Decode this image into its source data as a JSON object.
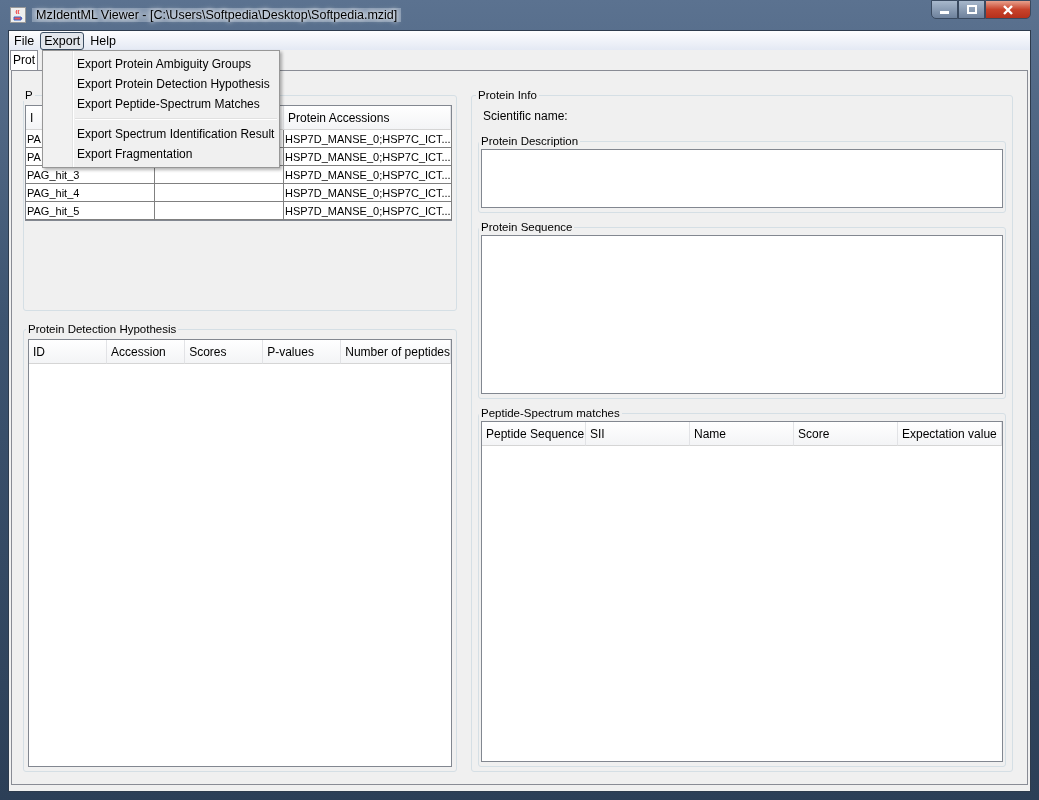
{
  "window": {
    "title": "MzIdentML Viewer   -  [C:\\Users\\Softpedia\\Desktop\\Softpedia.mzid]"
  },
  "menu_bar": [
    {
      "label": "File",
      "selected": false
    },
    {
      "label": "Export",
      "selected": true
    },
    {
      "label": "Help",
      "selected": false
    }
  ],
  "export_menu": [
    {
      "kind": "item",
      "label": "Export Protein Ambiguity Groups"
    },
    {
      "kind": "item",
      "label": "Export Protein Detection Hypothesis"
    },
    {
      "kind": "item",
      "label": "Export Peptide-Spectrum Matches"
    },
    {
      "kind": "separator"
    },
    {
      "kind": "item",
      "label": "Export Spectrum Identification Result"
    },
    {
      "kind": "item",
      "label": "Export Fragmentation"
    }
  ],
  "tabs": [
    {
      "label": "Prot",
      "selected": true
    }
  ],
  "ambiguity_groups": {
    "title": "P",
    "columns": [
      "I",
      "Protein Accessions"
    ],
    "rows": [
      {
        "id": "PA",
        "accessions": "HSP7D_MANSE_0;HSP7C_ICT..."
      },
      {
        "id": "PA",
        "accessions": "HSP7D_MANSE_0;HSP7C_ICT..."
      },
      {
        "id": "PAG_hit_3",
        "accessions": "HSP7D_MANSE_0;HSP7C_ICT..."
      },
      {
        "id": "PAG_hit_4",
        "accessions": "HSP7D_MANSE_0;HSP7C_ICT..."
      },
      {
        "id": "PAG_hit_5",
        "accessions": "HSP7D_MANSE_0;HSP7C_ICT..."
      }
    ]
  },
  "detection_hypothesis": {
    "title": "Protein Detection Hypothesis",
    "columns": [
      "ID",
      "Accession",
      "Scores",
      "P-values",
      "Number of peptides"
    ]
  },
  "protein_info": {
    "title": "Protein Info",
    "scientific_name_label": "Scientific name:",
    "description_title": "Protein Description",
    "sequence_title": "Protein Sequence",
    "matches": {
      "title": "Peptide-Spectrum matches",
      "columns": [
        "Peptide Sequence",
        "SII",
        "Name",
        "Score",
        "Expectation value"
      ]
    }
  }
}
